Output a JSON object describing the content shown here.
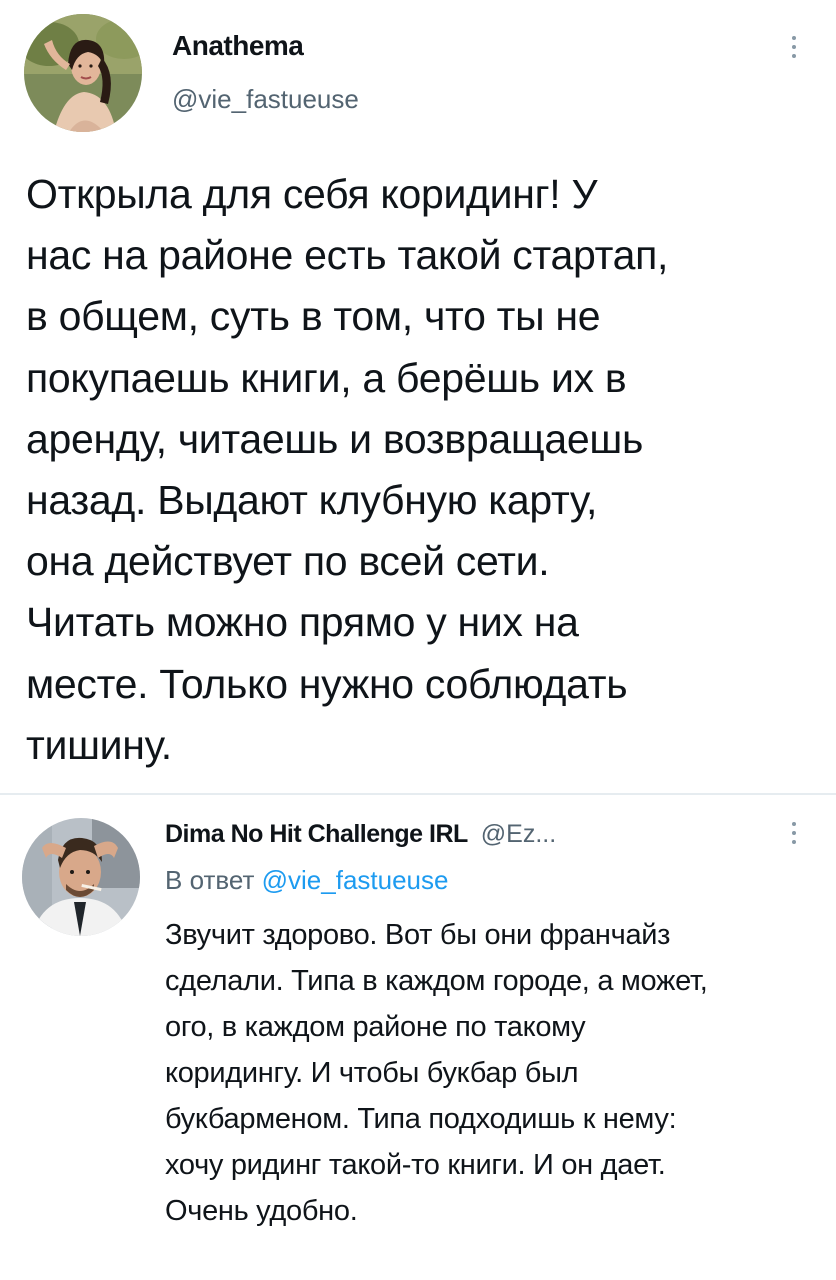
{
  "tweet": {
    "author_name": "Anathema",
    "author_handle": "@vie_fastueuse",
    "text": "Открыла для себя коридинг! У\nнас на районе есть такой стартап,\nв общем, суть в том, что ты не\nпокупаешь книги, а берёшь их в\nаренду, читаешь и возвращаешь\nназад. Выдают клубную карту,\nона действует по всей сети.\nЧитать можно прямо у них на\nместе. Только нужно соблюдать\nтишину."
  },
  "reply": {
    "author_name": "Dima No Hit Challenge IRL",
    "author_handle": "@Ez...",
    "reply_prefix": "В ответ",
    "reply_to_handle": "@vie_fastueuse",
    "text": "Звучит здорово. Вот бы они франчайз\nсделали. Типа в каждом городе, а может,\nого, в каждом районе по такому\nкоридингу. И чтобы букбар был\nбукбарменом. Типа подходишь к нему:\nхочу ридинг такой-то книги. И он дает.\nОчень удобно."
  },
  "icons": {
    "more": "more-vertical-icon"
  },
  "colors": {
    "text": "#0f1419",
    "secondary_text": "#536471",
    "link": "#1d9bf0",
    "divider": "#e6ecf0"
  }
}
